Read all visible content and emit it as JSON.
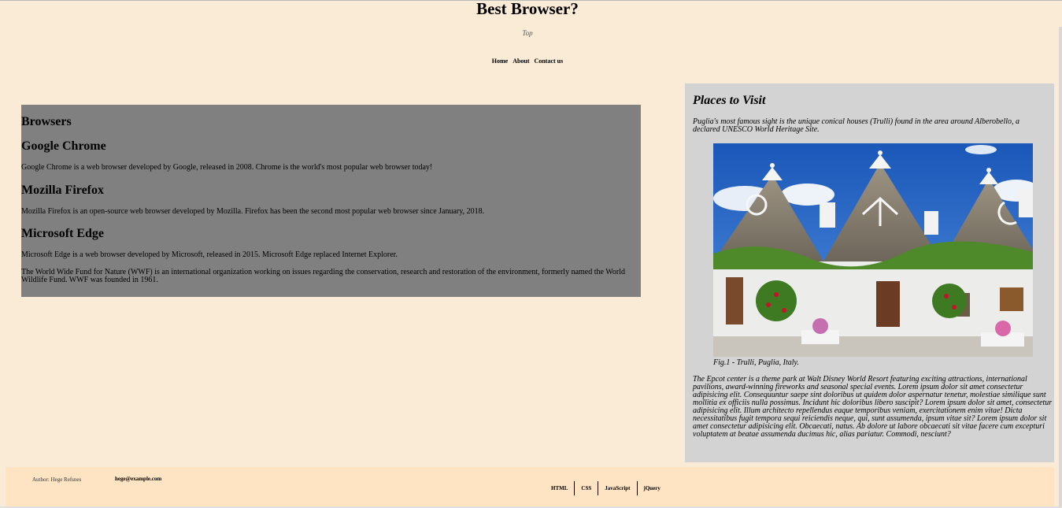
{
  "header": {
    "title": "Best Browser?",
    "subtitle": "Top",
    "nav": [
      "Home",
      "About",
      "Contact us"
    ]
  },
  "browsers": {
    "heading": "Browsers",
    "chrome_title": "Google Chrome",
    "chrome_text": "Google Chrome is a web browser developed by Google, released in 2008. Chrome is the world's most popular web browser today!",
    "firefox_title": "Mozilla Firefox",
    "firefox_text": "Mozilla Firefox is an open-source web browser developed by Mozilla. Firefox has been the second most popular web browser since January, 2018.",
    "edge_title": "Microsoft Edge",
    "edge_text": "Microsoft Edge is a web browser developed by Microsoft, released in 2015. Microsoft Edge replaced Internet Explorer.",
    "wwf_text": "The World Wide Fund for Nature (WWF) is an international organization working on issues regarding the conservation, research and restoration of the environment, formerly named the World Wildlife Fund. WWF was founded in 1961."
  },
  "aside": {
    "title": "Places to Visit",
    "intro": "Puglia's most famous sight is the unique conical houses (Trulli) found in the area around Alberobello, a declared UNESCO World Heritage Site.",
    "caption": "Fig.1 - Trulli, Puglia, Italy.",
    "epcot": "The Epcot center is a theme park at Walt Disney World Resort featuring exciting attractions, international pavilions, award-winning fireworks and seasonal special events. Lorem ipsum dolor sit amet consectetur adipisicing elit. Consequuntur saepe sint doloribus ut quidem dolor aspernatur tenetur, molestiae similique sunt mollitia ex officiis nulla possimus. Incidunt hic doloribus libero suscipit? Lorem ipsum dolor sit amet, consectetur adipisicing elit. Illum architecto repellendus eaque temporibus veniam, exercitationem enim vitae! Dicta necessitatibus fugit tempora sequi reiciendis neque, qui, sunt assumenda, ipsum vitae sit? Lorem ipsum dolor sit amet consectetur adipisicing elit. Obcaecati, natus. Ab dolore ut labore obcaecati sit vitae facere cum excepturi voluptatem at beatae assumenda ducimus hic, alias pariatur. Commodi, nesciunt?"
  },
  "footer": {
    "author": "Author: Hege Refsnes",
    "email": "hege@example.com",
    "links": [
      "HTML",
      "CSS",
      "JavaScript",
      "jQuery"
    ]
  },
  "colors": {
    "page_bg": "#faebd7",
    "browsers_bg": "#808080",
    "aside_bg": "#d3d3d3",
    "footer_bg": "#ffe4c4"
  }
}
